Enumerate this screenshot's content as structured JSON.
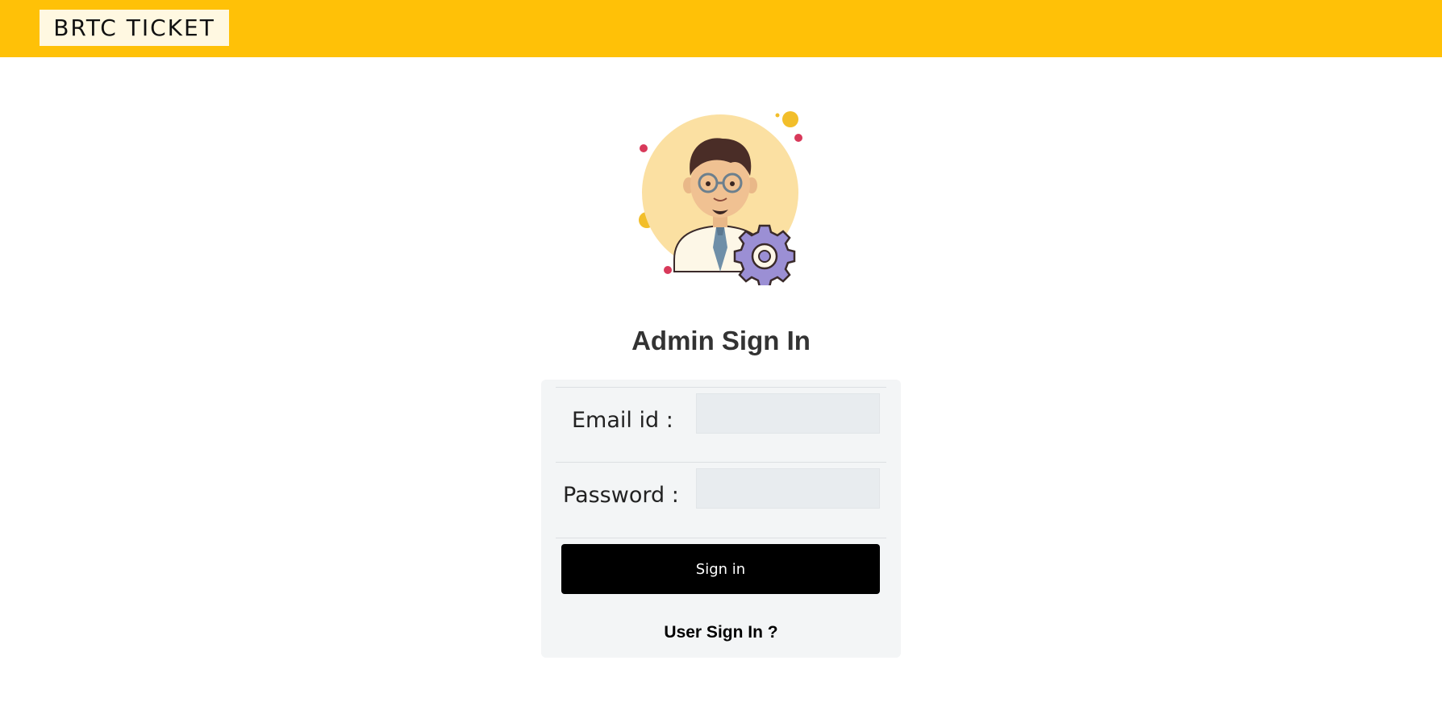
{
  "navbar": {
    "brand": "BRTC TICKET",
    "color": "#ffc107"
  },
  "avatar": {
    "icon": "admin-avatar-gear-icon"
  },
  "page": {
    "title": "Admin Sign In"
  },
  "form": {
    "email_label": "Email id :",
    "email_value": "",
    "password_label": "Password :",
    "password_value": "",
    "submit_label": "Sign in",
    "user_link": "User Sign In ?"
  }
}
